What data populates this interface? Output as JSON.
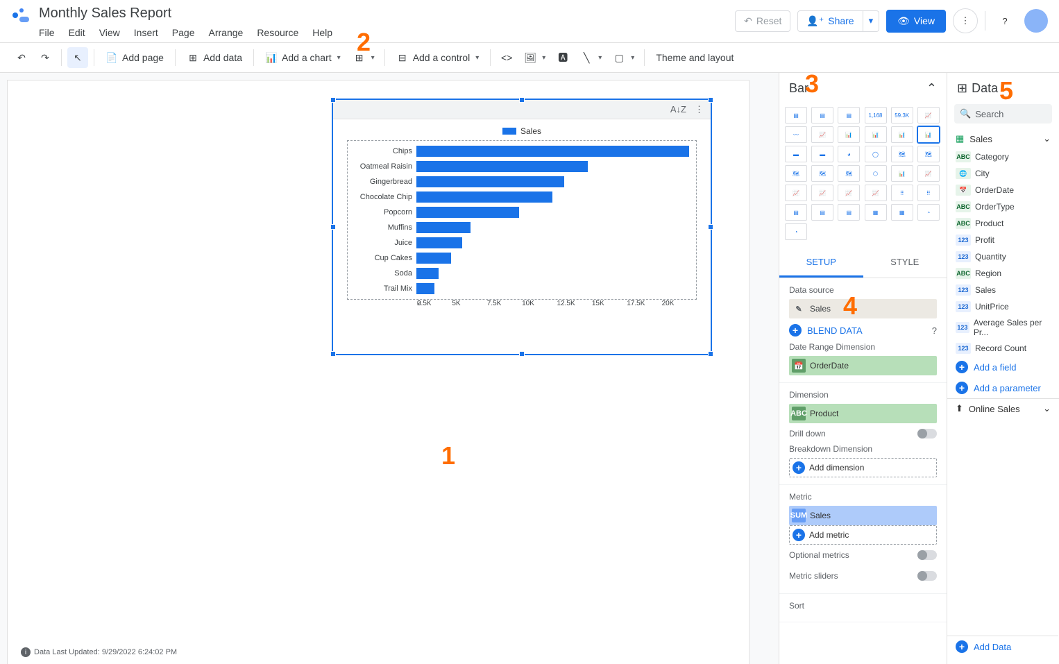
{
  "doc_title": "Monthly Sales Report",
  "menu": {
    "file": "File",
    "edit": "Edit",
    "view": "View",
    "insert": "Insert",
    "page": "Page",
    "arrange": "Arrange",
    "resource": "Resource",
    "help": "Help"
  },
  "header_actions": {
    "reset": "Reset",
    "share": "Share",
    "view": "View"
  },
  "toolbar": {
    "add_page": "Add page",
    "add_data": "Add data",
    "add_chart": "Add a chart",
    "add_control": "Add a control",
    "theme": "Theme and layout"
  },
  "chart_panel": {
    "type_name": "Bar",
    "tab_setup": "SETUP",
    "tab_style": "STYLE",
    "data_source_label": "Data source",
    "data_source_value": "Sales",
    "blend": "BLEND DATA",
    "date_range_label": "Date Range Dimension",
    "date_range_value": "OrderDate",
    "dimension_label": "Dimension",
    "dimension_value": "Product",
    "drill_down": "Drill down",
    "breakdown_label": "Breakdown Dimension",
    "add_dimension": "Add dimension",
    "metric_label": "Metric",
    "metric_prefix": "SUM",
    "metric_value": "Sales",
    "add_metric": "Add metric",
    "optional_metrics": "Optional metrics",
    "metric_sliders": "Metric sliders",
    "sort_label": "Sort"
  },
  "data_panel": {
    "title": "Data",
    "search_placeholder": "Search",
    "source": "Sales",
    "fields": [
      {
        "type": "ABC",
        "name": "Category"
      },
      {
        "type": "GEO",
        "name": "City"
      },
      {
        "type": "DATE",
        "name": "OrderDate"
      },
      {
        "type": "ABC",
        "name": "OrderType"
      },
      {
        "type": "ABC",
        "name": "Product"
      },
      {
        "type": "123",
        "name": "Profit"
      },
      {
        "type": "123",
        "name": "Quantity"
      },
      {
        "type": "ABC",
        "name": "Region"
      },
      {
        "type": "123",
        "name": "Sales"
      },
      {
        "type": "123",
        "name": "UnitPrice"
      },
      {
        "type": "123",
        "name": "Average Sales per Pr..."
      },
      {
        "type": "123",
        "name": "Record Count"
      }
    ],
    "add_field": "Add a field",
    "add_parameter": "Add a parameter",
    "online_sales": "Online Sales",
    "add_data": "Add Data"
  },
  "status_bar": "Data Last Updated: 9/29/2022 6:24:02 PM",
  "chart_data": {
    "type": "bar",
    "orientation": "horizontal",
    "title": "",
    "legend": "Sales",
    "categories": [
      "Chips",
      "Oatmeal Raisin",
      "Gingerbread",
      "Chocolate Chip",
      "Popcorn",
      "Muffins",
      "Juice",
      "Cup Cakes",
      "Soda",
      "Trail Mix"
    ],
    "values": [
      19700,
      12400,
      10700,
      9800,
      7400,
      3900,
      3300,
      2500,
      1600,
      1300
    ],
    "xticks": [
      "0",
      "2.5K",
      "5K",
      "7.5K",
      "10K",
      "12.5K",
      "15K",
      "17.5K",
      "20K"
    ],
    "xmax": 20000,
    "xlabel": "",
    "ylabel": ""
  },
  "annotations": {
    "a1": "1",
    "a2": "2",
    "a3": "3",
    "a4": "4",
    "a5": "5"
  }
}
